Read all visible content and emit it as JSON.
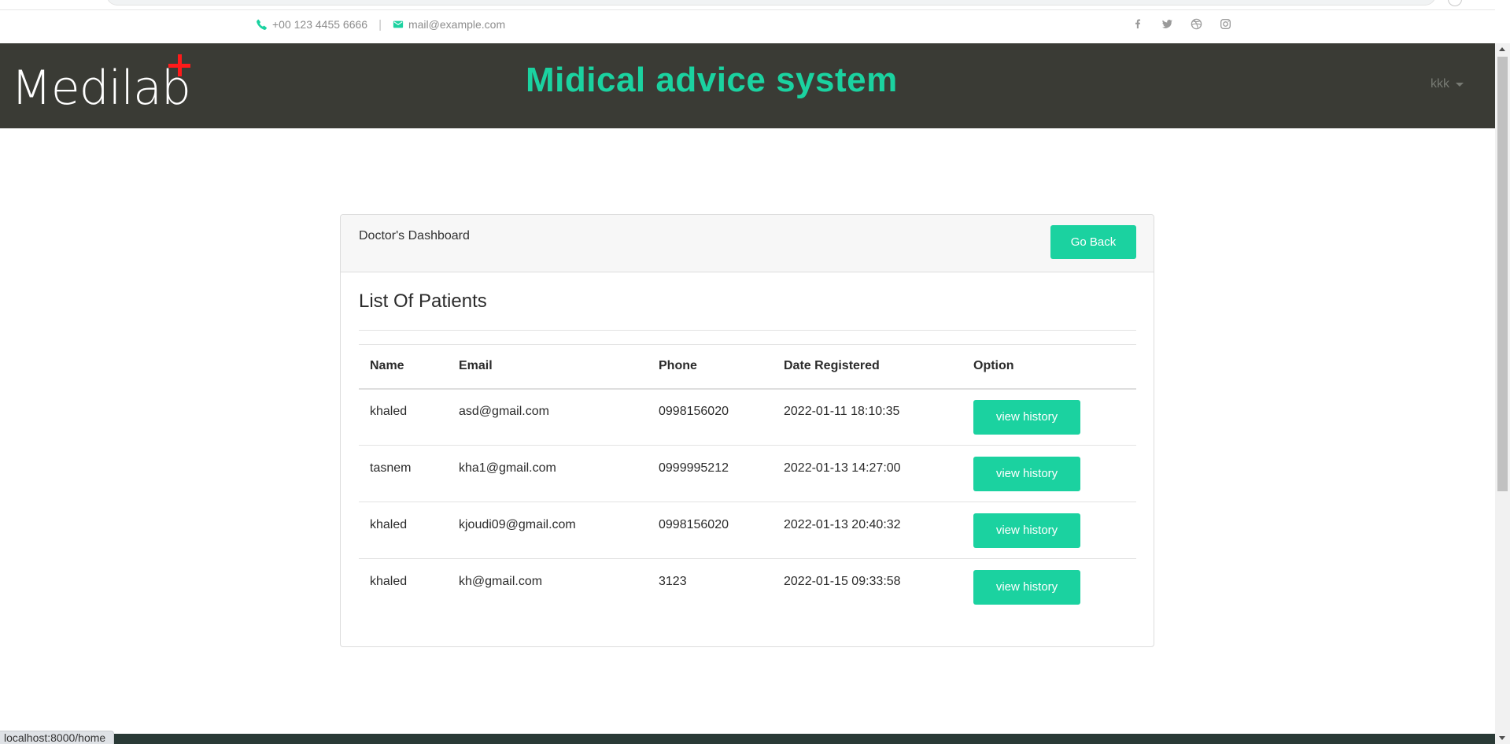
{
  "topbar": {
    "phone": "+00 123 4455 6666",
    "separator": "|",
    "email": "mail@example.com",
    "social_icons": [
      "facebook-icon",
      "twitter-icon",
      "dribbble-icon",
      "instagram-icon"
    ]
  },
  "header": {
    "logo_text": "Medilab",
    "title": "Midical advice system",
    "user": "kkk"
  },
  "card": {
    "header_title": "Doctor's Dashboard",
    "go_back_label": "Go Back",
    "list_title": "List Of Patients"
  },
  "table": {
    "columns": [
      "Name",
      "Email",
      "Phone",
      "Date Registered",
      "Option"
    ],
    "rows": [
      {
        "name": "khaled",
        "email": "asd@gmail.com",
        "phone": "0998156020",
        "date": "2022-01-11 18:10:35",
        "option": "view history"
      },
      {
        "name": "tasnem",
        "email": "kha1@gmail.com",
        "phone": "0999995212",
        "date": "2022-01-13 14:27:00",
        "option": "view history"
      },
      {
        "name": "khaled",
        "email": "kjoudi09@gmail.com",
        "phone": "0998156020",
        "date": "2022-01-13 20:40:32",
        "option": "view history"
      },
      {
        "name": "khaled",
        "email": "kh@gmail.com",
        "phone": "3123",
        "date": "2022-01-15 09:33:58",
        "option": "view history"
      }
    ]
  },
  "status_bar": {
    "url": "localhost:8000/home"
  },
  "colors": {
    "accent": "#1bd2a0",
    "header_bg": "#3a3b35",
    "logo_plus": "#ff1a1a",
    "footer_bg": "#2a3a36"
  }
}
